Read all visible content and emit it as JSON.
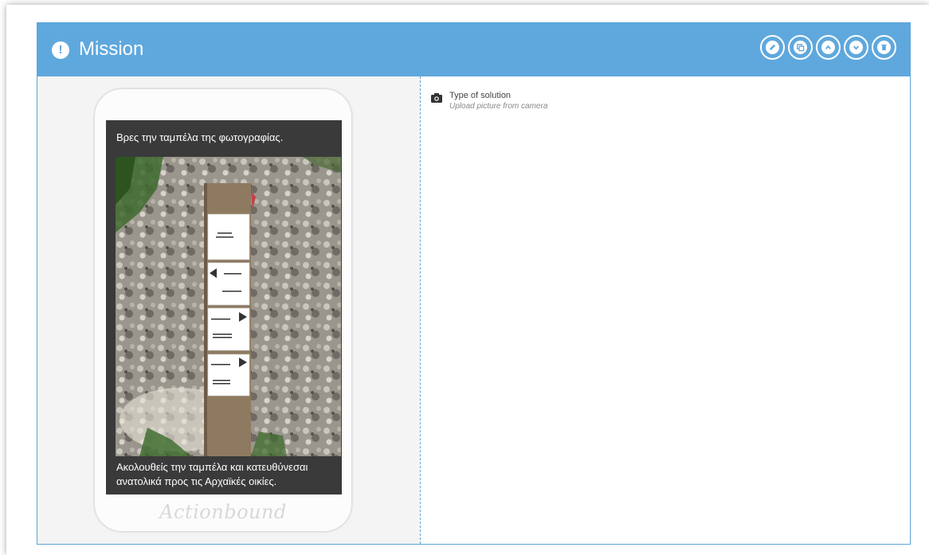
{
  "header": {
    "title": "Mission",
    "buttons": [
      {
        "name": "edit",
        "icon": "pencil-icon"
      },
      {
        "name": "copy",
        "icon": "copy-icon"
      },
      {
        "name": "move-up",
        "icon": "chevron-up-icon"
      },
      {
        "name": "move-down",
        "icon": "chevron-down-icon"
      },
      {
        "name": "delete",
        "icon": "trash-icon"
      }
    ],
    "accent_color": "#5fa8dd"
  },
  "preview": {
    "top_text": "Βρες την ταμπέλα της φωτογραφίας.",
    "bottom_text": "Ακολουθείς την ταμπέλα και κατευθύνεσαι ανατολικά προς τις Αρχαϊκές οικίες.",
    "brand": "Actionbound"
  },
  "solution": {
    "type_label": "Type of solution",
    "type_value": "Upload picture from camera",
    "icon": "camera-icon"
  }
}
